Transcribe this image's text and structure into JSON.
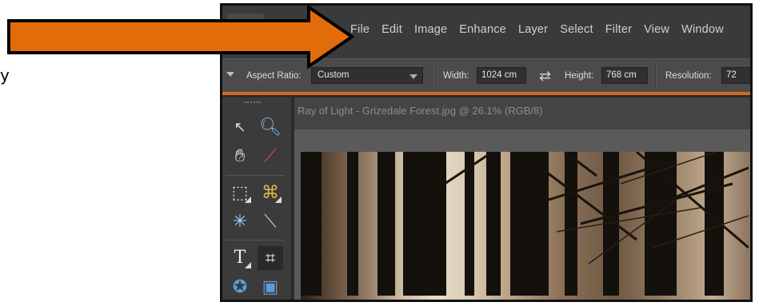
{
  "stray_text": "y",
  "menubar": {
    "items": [
      "File",
      "Edit",
      "Image",
      "Enhance",
      "Layer",
      "Select",
      "Filter",
      "View",
      "Window"
    ]
  },
  "options_bar": {
    "aspect_ratio_label": "Aspect Ratio:",
    "aspect_ratio_value": "Custom",
    "width_label": "Width:",
    "width_value": "1024 cm",
    "height_label": "Height:",
    "height_value": "768 cm",
    "resolution_label": "Resolution:",
    "resolution_value": "72"
  },
  "document": {
    "tab_title": "Ray of Light - Grizedale Forest.jpg @ 26.1% (RGB/8)"
  },
  "tools": [
    "move-tool",
    "zoom-tool",
    "hand-tool",
    "eyedropper-tool",
    "rectangular-marquee-tool",
    "polygonal-lasso-tool",
    "magic-wand-tool",
    "quick-selection-tool",
    "type-tool",
    "crop-tool",
    "cookie-cutter-tool",
    "recompose-tool"
  ],
  "colors": {
    "annotation_arrow": "#E36C0A",
    "accent_line": "#D2691E"
  }
}
